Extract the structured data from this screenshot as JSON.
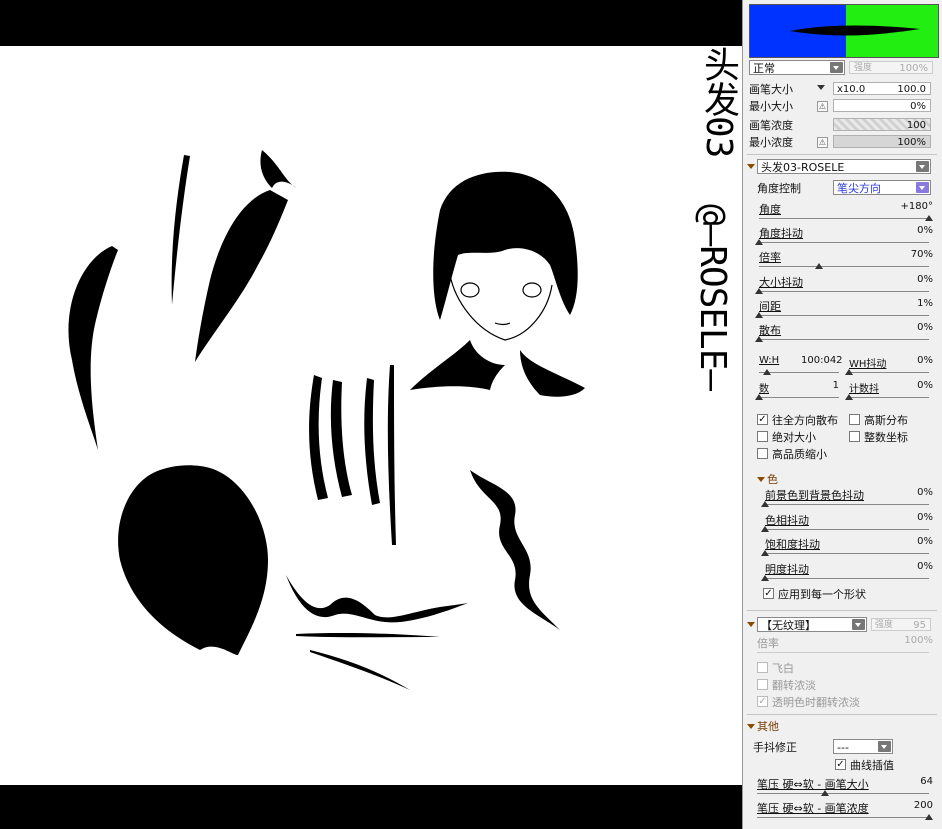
{
  "canvas": {
    "vertical_title_1": "头发03",
    "vertical_title_2": "@—ROSELE—"
  },
  "panel": {
    "blend_mode": "正常",
    "opacity_label": "强度",
    "opacity_value": "100%",
    "brush_size": {
      "label": "画笔大小",
      "multiplier": "x10.0",
      "value": "100.0"
    },
    "min_size": {
      "label": "最小大小",
      "value": "0%"
    },
    "brush_density": {
      "label": "画笔浓度",
      "value": "100"
    },
    "min_density": {
      "label": "最小浓度",
      "value": "100%"
    },
    "brush_shape": "头发03-ROSELE",
    "angle_control": {
      "label": "角度控制",
      "value": "笔尖方向"
    },
    "angle": {
      "label": "角度",
      "value": "+180°",
      "level": 1.0
    },
    "angle_jitter": {
      "label": "角度抖动",
      "value": "0%",
      "level": 0
    },
    "ratio": {
      "label": "倍率",
      "value": "70%",
      "level": 0.35
    },
    "size_jitter": {
      "label": "大小抖动",
      "value": "0%",
      "level": 0
    },
    "spacing": {
      "label": "间距",
      "value": "1%",
      "level": 0
    },
    "scatter": {
      "label": "散布",
      "value": "0%",
      "level": 0
    },
    "wh": {
      "label": "W:H",
      "value": "100:042",
      "level": 0.1
    },
    "wh_jitter": {
      "label": "WH抖动",
      "value": "0%",
      "level": 0
    },
    "count": {
      "label": "数",
      "value": "1",
      "level": 0
    },
    "count_jitter": {
      "label": "计数抖",
      "value": "0%",
      "level": 0
    },
    "checkboxes": [
      {
        "label": "往全方向散布",
        "checked": true
      },
      {
        "label": "高斯分布",
        "checked": false
      },
      {
        "label": "绝对大小",
        "checked": false
      },
      {
        "label": "整数坐标",
        "checked": false
      },
      {
        "label": "高品质缩小",
        "checked": false
      }
    ],
    "color_section": {
      "title": "色",
      "fg_bg_jitter": {
        "label": "前景色到背景色抖动",
        "value": "0%"
      },
      "hue_jitter": {
        "label": "色相抖动",
        "value": "0%"
      },
      "sat_jitter": {
        "label": "饱和度抖动",
        "value": "0%"
      },
      "bright_jitter": {
        "label": "明度抖动",
        "value": "0%"
      },
      "apply_each": {
        "label": "应用到每一个形状",
        "checked": true
      }
    },
    "texture_section": {
      "texture": "【无纹理】",
      "strength_label": "强度",
      "strength_value": "95",
      "ratio_label": "倍率",
      "ratio_value": "100%",
      "flying_white": "飞白",
      "invert_density": "翻转浓淡",
      "invert_on_transparent": "透明色时翻转浓淡"
    },
    "other_section": {
      "title": "其他",
      "stabilizer_label": "手抖修正",
      "stabilizer_value": "---",
      "curve_interp": {
        "label": "曲线插值",
        "checked": true
      },
      "pressure_size": {
        "label": "笔压 硬⇔软 - 画笔大小",
        "value": "64"
      },
      "pressure_density": {
        "label": "笔压 硬⇔软 - 画笔浓度",
        "value": "200"
      }
    }
  },
  "colors": {
    "preview_left": "#0033ff",
    "preview_right": "#22ee11",
    "section_title": "#7a3b00",
    "accent_text": "#2a3bd6"
  }
}
